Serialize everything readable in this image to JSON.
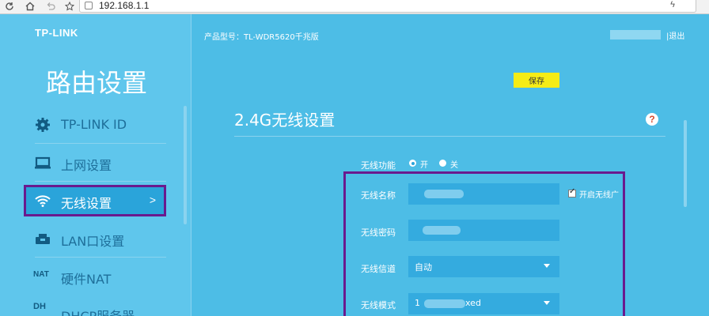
{
  "browser": {
    "url": "192.168.1.1"
  },
  "sidebar": {
    "logo": "TP-LINK",
    "title": "路由设置",
    "items": [
      {
        "label": "TP-LINK ID",
        "icon": "gear-icon"
      },
      {
        "label": "上网设置",
        "icon": "monitor-icon"
      },
      {
        "label": "无线设置",
        "icon": "wifi-icon",
        "active": true,
        "arrow": ">"
      },
      {
        "label": "LAN口设置",
        "icon": "lan-icon"
      },
      {
        "label": "硬件NAT",
        "icon": "nat-icon",
        "icon_text": "NAT"
      },
      {
        "label": "DHCP服务器",
        "icon": "dhcp-icon",
        "icon_text": "DH"
      }
    ]
  },
  "header": {
    "product": "产品型号：TL-WDR5620千兆版",
    "logout": "|退出"
  },
  "toolbar": {
    "save_label": "保存"
  },
  "wireless": {
    "section_title": "2.4G无线设置",
    "help": "?",
    "function_label": "无线功能",
    "on_label": "开",
    "off_label": "关",
    "ssid_label": "无线名称",
    "broadcast_label": "开启无线广",
    "password_label": "无线密码",
    "channel_label": "无线信道",
    "channel_value": "自动",
    "mode_label": "无线模式",
    "mode_value_prefix": "1",
    "mode_value_suffix": "xed"
  },
  "colors": {
    "background": "#4dbde6",
    "sidebar": "#5fc6ec",
    "active_item": "#2aa4da",
    "highlight": "#6a1a8e",
    "save_button": "#f5ec16"
  }
}
